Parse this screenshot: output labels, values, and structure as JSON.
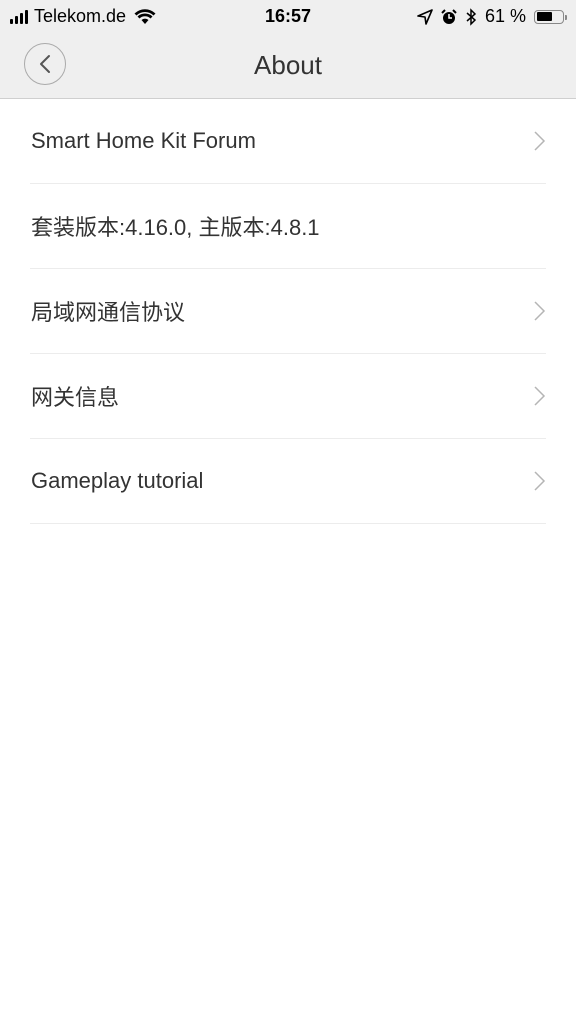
{
  "status_bar": {
    "carrier": "Telekom.de",
    "time": "16:57",
    "battery_percent_label": "61 %",
    "battery_level": 0.61,
    "icons": [
      "signal-icon",
      "wifi-icon",
      "location-icon",
      "alarm-icon",
      "bluetooth-icon",
      "battery-icon"
    ]
  },
  "header": {
    "title": "About",
    "back_icon": "chevron-left-icon"
  },
  "list": {
    "items": [
      {
        "label": "Smart Home Kit Forum",
        "has_chevron": true
      },
      {
        "label": "套装版本:4.16.0, 主版本:4.8.1",
        "has_chevron": false
      },
      {
        "label": "局域网通信协议",
        "has_chevron": true
      },
      {
        "label": "网关信息",
        "has_chevron": true
      },
      {
        "label": "Gameplay tutorial",
        "has_chevron": true
      }
    ]
  }
}
